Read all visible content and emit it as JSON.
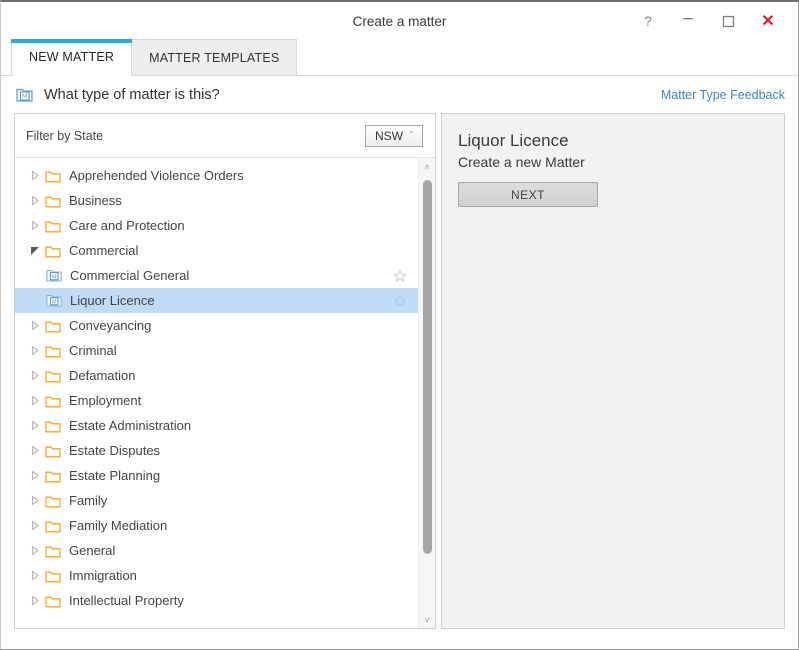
{
  "window": {
    "title": "Create a matter",
    "buttons": {
      "help": "?",
      "minimize": "_",
      "maximize": "maximize-icon",
      "close": "✕"
    }
  },
  "tabs": [
    {
      "label": "NEW MATTER",
      "active": true
    },
    {
      "label": "MATTER TEMPLATES",
      "active": false
    }
  ],
  "question": {
    "icon": "matter-icon",
    "text": "What type of matter is this?",
    "feedback_link": "Matter Type Feedback"
  },
  "filter": {
    "label": "Filter by State",
    "state_value": "NSW",
    "chevron": "ˇ"
  },
  "tree": {
    "items": [
      {
        "label": "Apprehended Violence Orders",
        "type": "folder",
        "level": 0,
        "expanded": false,
        "selected": false,
        "star": false
      },
      {
        "label": "Business",
        "type": "folder",
        "level": 0,
        "expanded": false,
        "selected": false,
        "star": false
      },
      {
        "label": "Care and Protection",
        "type": "folder",
        "level": 0,
        "expanded": false,
        "selected": false,
        "star": false
      },
      {
        "label": "Commercial",
        "type": "folder",
        "level": 0,
        "expanded": true,
        "selected": false,
        "star": false
      },
      {
        "label": "Commercial General",
        "type": "matter",
        "level": 1,
        "expanded": false,
        "selected": false,
        "star": true
      },
      {
        "label": "Liquor Licence",
        "type": "matter",
        "level": 1,
        "expanded": false,
        "selected": true,
        "star": true
      },
      {
        "label": "Conveyancing",
        "type": "folder",
        "level": 0,
        "expanded": false,
        "selected": false,
        "star": false
      },
      {
        "label": "Criminal",
        "type": "folder",
        "level": 0,
        "expanded": false,
        "selected": false,
        "star": false
      },
      {
        "label": "Defamation",
        "type": "folder",
        "level": 0,
        "expanded": false,
        "selected": false,
        "star": false
      },
      {
        "label": "Employment",
        "type": "folder",
        "level": 0,
        "expanded": false,
        "selected": false,
        "star": false
      },
      {
        "label": "Estate Administration",
        "type": "folder",
        "level": 0,
        "expanded": false,
        "selected": false,
        "star": false
      },
      {
        "label": "Estate Disputes",
        "type": "folder",
        "level": 0,
        "expanded": false,
        "selected": false,
        "star": false
      },
      {
        "label": "Estate Planning",
        "type": "folder",
        "level": 0,
        "expanded": false,
        "selected": false,
        "star": false
      },
      {
        "label": "Family",
        "type": "folder",
        "level": 0,
        "expanded": false,
        "selected": false,
        "star": false
      },
      {
        "label": "Family Mediation",
        "type": "folder",
        "level": 0,
        "expanded": false,
        "selected": false,
        "star": false
      },
      {
        "label": "General",
        "type": "folder",
        "level": 0,
        "expanded": false,
        "selected": false,
        "star": false
      },
      {
        "label": "Immigration",
        "type": "folder",
        "level": 0,
        "expanded": false,
        "selected": false,
        "star": false
      },
      {
        "label": "Intellectual Property",
        "type": "folder",
        "level": 0,
        "expanded": false,
        "selected": false,
        "star": false
      }
    ],
    "scrollbar": {
      "up_arrow": "˄",
      "down_arrow": "˅"
    }
  },
  "detail": {
    "title": "Liquor Licence",
    "subtitle": "Create a new Matter",
    "next_label": "NEXT"
  },
  "colors": {
    "accent": "#29ABE2",
    "link": "#3d85c6",
    "selection": "#bfdcf4",
    "folder": "#F5A623",
    "close": "#e01b24"
  }
}
